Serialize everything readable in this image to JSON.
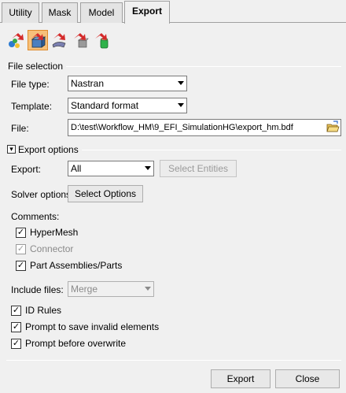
{
  "tabs": [
    {
      "label": "Utility"
    },
    {
      "label": "Mask"
    },
    {
      "label": "Model"
    },
    {
      "label": "Export"
    }
  ],
  "toolbar": {
    "icons": [
      "export-solver-deck-icon",
      "export-geometry-icon",
      "export-fe-icon",
      "export-cad-icon",
      "export-results-icon",
      "export-tcl-icon"
    ]
  },
  "file_selection": {
    "section_label": "File selection",
    "file_type_label": "File type:",
    "file_type_value": "Nastran",
    "template_label": "Template:",
    "template_value": "Standard format",
    "file_label": "File:",
    "file_value": "D:\\test\\Workflow_HM\\9_EFI_SimulationHG\\export_hm.bdf"
  },
  "export_options": {
    "section_label": "Export options",
    "export_label": "Export:",
    "export_value": "All",
    "select_entities_label": "Select Entities",
    "solver_options_label": "Solver options:",
    "select_options_label": "Select Options",
    "comments_label": "Comments:",
    "comments": [
      {
        "label": "HyperMesh",
        "checked": true,
        "enabled": true
      },
      {
        "label": "Connector",
        "checked": true,
        "enabled": false
      },
      {
        "label": "Part Assemblies/Parts",
        "checked": true,
        "enabled": true
      }
    ],
    "include_files_label": "Include files:",
    "include_files_value": "Merge",
    "flags": [
      {
        "label": "ID Rules",
        "checked": true
      },
      {
        "label": "Prompt to save invalid elements",
        "checked": true
      },
      {
        "label": "Prompt before overwrite",
        "checked": true
      }
    ]
  },
  "footer": {
    "export_button": "Export",
    "close_button": "Close"
  },
  "colors": {
    "background": "#f0f0f0",
    "selected_tool_bg": "#f6c07a",
    "arrow_red": "#d42a2a"
  }
}
